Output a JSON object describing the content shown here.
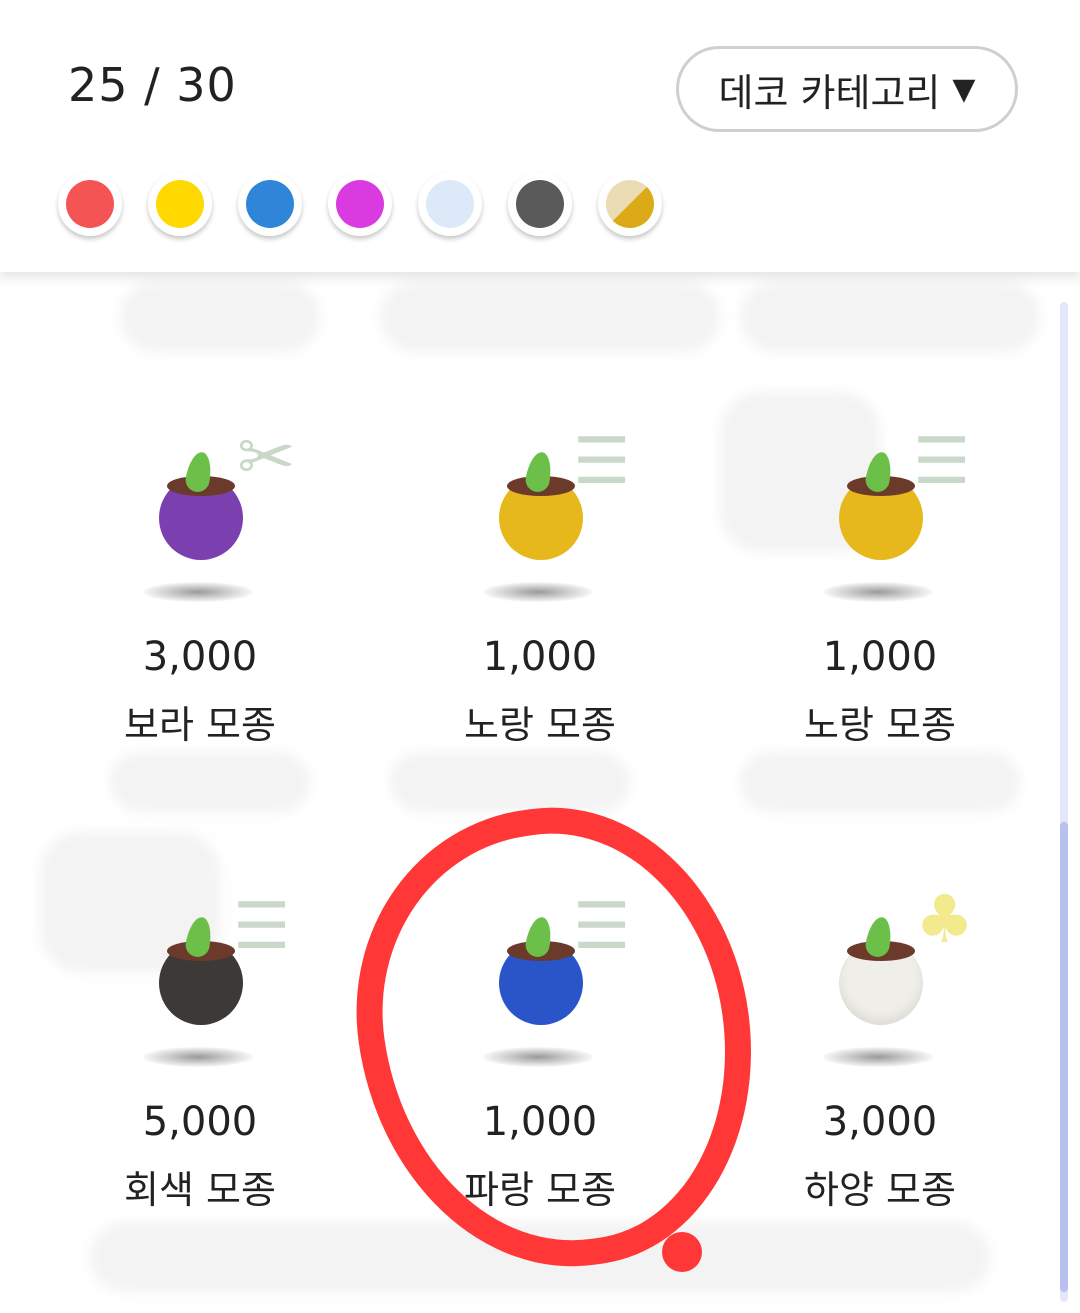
{
  "header": {
    "counter": "25 / 30",
    "category_label": "데코 카테고리",
    "category_arrow": "▼"
  },
  "swatches": [
    {
      "name": "red",
      "color": "#f55454"
    },
    {
      "name": "yellow",
      "color": "#ffd800"
    },
    {
      "name": "blue",
      "color": "#2f86d9"
    },
    {
      "name": "magenta",
      "color": "#d93be0"
    },
    {
      "name": "light-blue",
      "color": "#dde9f8"
    },
    {
      "name": "gray",
      "color": "#5a5a5a"
    },
    {
      "name": "beige-gold",
      "color": "#e8d7a8"
    }
  ],
  "items": [
    {
      "price": "3,000",
      "name": "보라 모종",
      "pot_color": "#7b3fb0",
      "deco_icon": "scissors-icon"
    },
    {
      "price": "1,000",
      "name": "노랑 모종",
      "pot_color": "#e6b81c",
      "deco_icon": "bench-icon"
    },
    {
      "price": "1,000",
      "name": "노랑 모종",
      "pot_color": "#e6b81c",
      "deco_icon": "bench-icon"
    },
    {
      "price": "5,000",
      "name": "회색 모종",
      "pot_color": "#3c3a36",
      "deco_icon": "bench-icon"
    },
    {
      "price": "1,000",
      "name": "파랑 모종",
      "pot_color": "#2a55c8",
      "deco_icon": "bench-icon"
    },
    {
      "price": "3,000",
      "name": "하양 모종",
      "pot_color": "#f0eee8",
      "deco_icon": "tree-bench-icon"
    }
  ]
}
